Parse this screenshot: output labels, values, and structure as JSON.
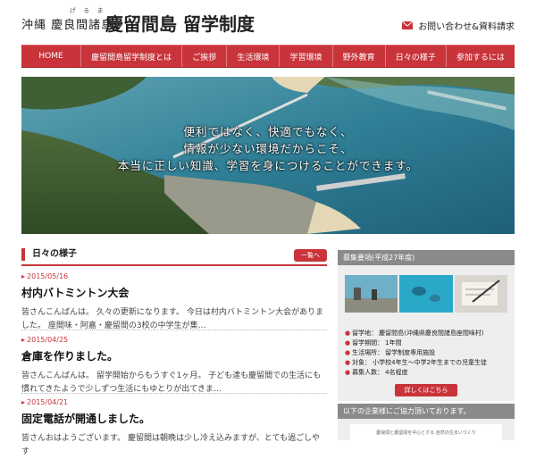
{
  "header": {
    "brand_prefix": "沖縄 慶良間諸島",
    "ruby": "げ る ま",
    "brand_main": "慶留間島 留学制度",
    "contact_label": "お問い合わせ&資料請求",
    "mail_icon": "mail-icon"
  },
  "nav": {
    "items": [
      "HOME",
      "慶留間島留学制度とは",
      "ご挨拶",
      "生活環境",
      "学習環境",
      "野外教育",
      "日々の様子",
      "参加するには"
    ]
  },
  "hero": {
    "lines": [
      "便利ではなく、快適でもなく、",
      "情報が少ない環境だからこそ、",
      "本当に正しい知識、学習を身につけることができます。"
    ]
  },
  "diary": {
    "title": "日々の様子",
    "list_button": "一覧へ",
    "posts": [
      {
        "date": "2015/05/16",
        "title": "村内バトミントン大会",
        "body": "皆さんこんばんは。 久々の更新になります。 今日は村内バトミントン大会がありました。 座間味・阿嘉・慶留間の3校の中学生が集…"
      },
      {
        "date": "2015/04/25",
        "title": "倉庫を作りました。",
        "body": "皆さんこんばんは。 留学開始からもうすぐ1ヶ月。 子ども達も慶留間での生活にも慣れてきたようで少しずつ生活にもゆとりが出てきま…"
      },
      {
        "date": "2015/04/21",
        "title": "固定電話が開通しました。",
        "body": "皆さんおはようございます。 慶留間は朝晩は少し冷え込みますが、とても過ごしやす"
      }
    ]
  },
  "recruit": {
    "title": "募集要項(平成27年度)",
    "rows": [
      {
        "label": "留学地：",
        "value": "慶留間島(沖縄県慶良間諸島座間味村)"
      },
      {
        "label": "留学期間：",
        "value": "1年間"
      },
      {
        "label": "生活場所：",
        "value": "留学制度専用施設"
      },
      {
        "label": "対象：",
        "value": "小学校4年生〜中学2年生までの児童生徒"
      },
      {
        "label": "募集人数：",
        "value": "4名程度"
      }
    ],
    "detail_button": "詳しくはこちら"
  },
  "sponsor": {
    "title": "以下の企業様にご協力頂いております。",
    "ad_text": "慶良間と慶留間を中心とする 自然の住まいづくり"
  },
  "colors": {
    "accent": "#c8343a",
    "sea": "#3c8fa3",
    "side_header": "#8a8a8a"
  }
}
